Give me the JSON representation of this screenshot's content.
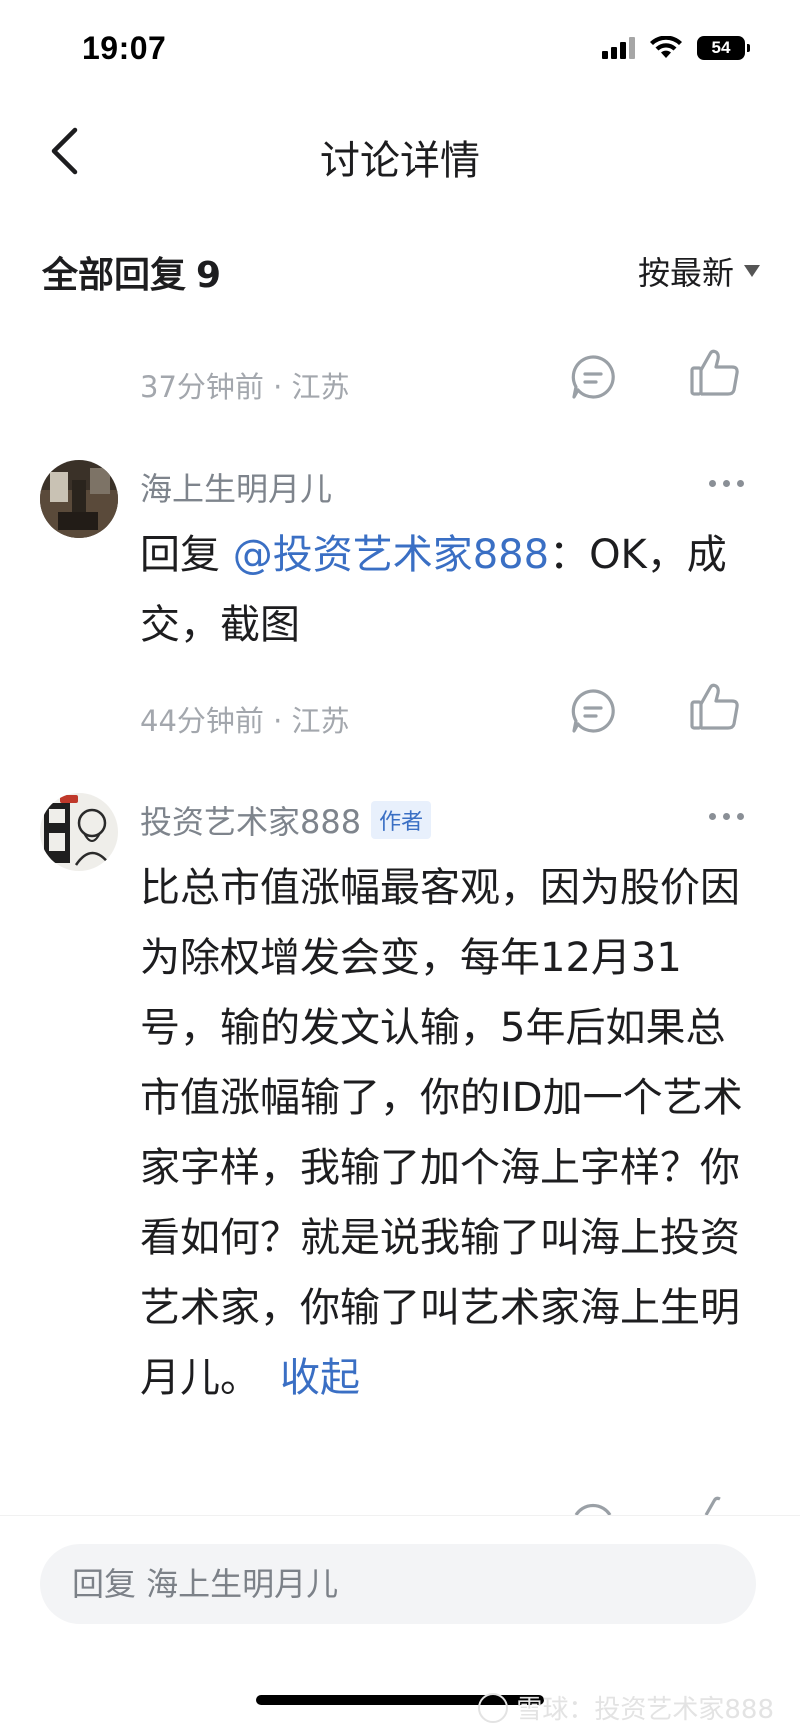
{
  "status_bar": {
    "time": "19:07",
    "battery": "54"
  },
  "nav": {
    "title": "讨论详情"
  },
  "reply_header": {
    "label": "全部回复",
    "count": "9",
    "sort_label": "按最新"
  },
  "comments": [
    {
      "meta": "37分钟前 · 江苏"
    },
    {
      "author": "海上生明月儿",
      "reply_prefix": "回复 ",
      "mention": "@投资艺术家888",
      "text_after_mention": "：OK，成交，截图",
      "meta": "44分钟前 · 江苏"
    },
    {
      "author": "投资艺术家888",
      "author_tag": "作者",
      "text": "比总市值涨幅最客观，因为股价因为除权增发会变，每年12月31号，输的发文认输，5年后如果总市值涨幅输了，你的ID加一个艺术家字样，我输了加个海上字样？你看如何？就是说我输了叫海上投资艺术家，你输了叫艺术家海上生明月儿。",
      "collapse_label": "收起"
    }
  ],
  "input": {
    "placeholder": "回复 海上生明月儿"
  },
  "watermark": {
    "text": "雪球：投资艺术家888"
  },
  "colors": {
    "link": "#3a6fc4",
    "meta": "#a3a7ad"
  }
}
